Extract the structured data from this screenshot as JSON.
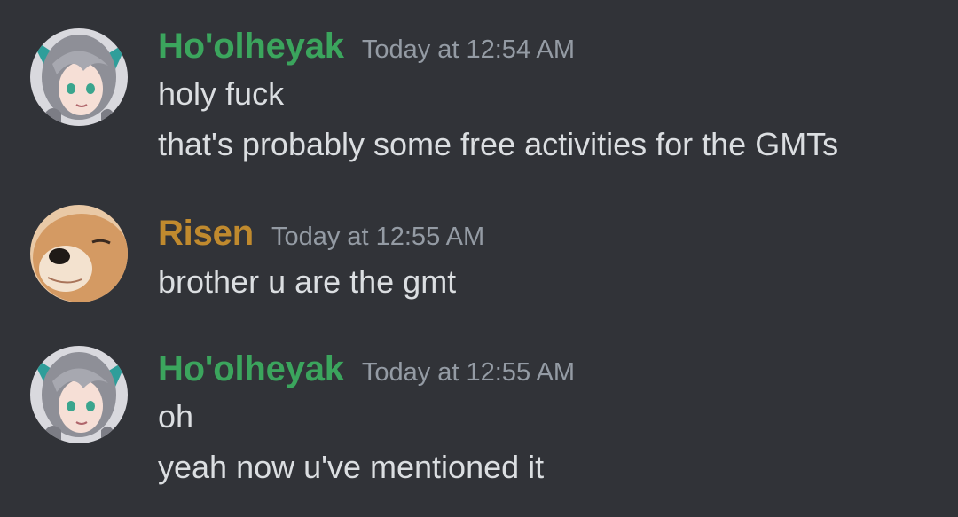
{
  "colors": {
    "background": "#313338",
    "text": "#dbdee1",
    "timestamp": "#949ba4",
    "holheyak_name": "#3ba55d",
    "risen_name": "#c08a2e"
  },
  "messages": [
    {
      "username": "Ho'olheyak",
      "name_color": "#3ba55d",
      "avatar": "anime-girl-avatar",
      "timestamp": "Today at 12:54 AM",
      "lines": [
        "holy fuck",
        "that's probably some free activities for the GMTs"
      ]
    },
    {
      "username": "Risen",
      "name_color": "#c08a2e",
      "avatar": "shiba-dog-avatar",
      "timestamp": "Today at 12:55 AM",
      "lines": [
        "brother u are the gmt"
      ]
    },
    {
      "username": "Ho'olheyak",
      "name_color": "#3ba55d",
      "avatar": "anime-girl-avatar",
      "timestamp": "Today at 12:55 AM",
      "lines": [
        "oh",
        "yeah now u've mentioned it"
      ]
    }
  ]
}
